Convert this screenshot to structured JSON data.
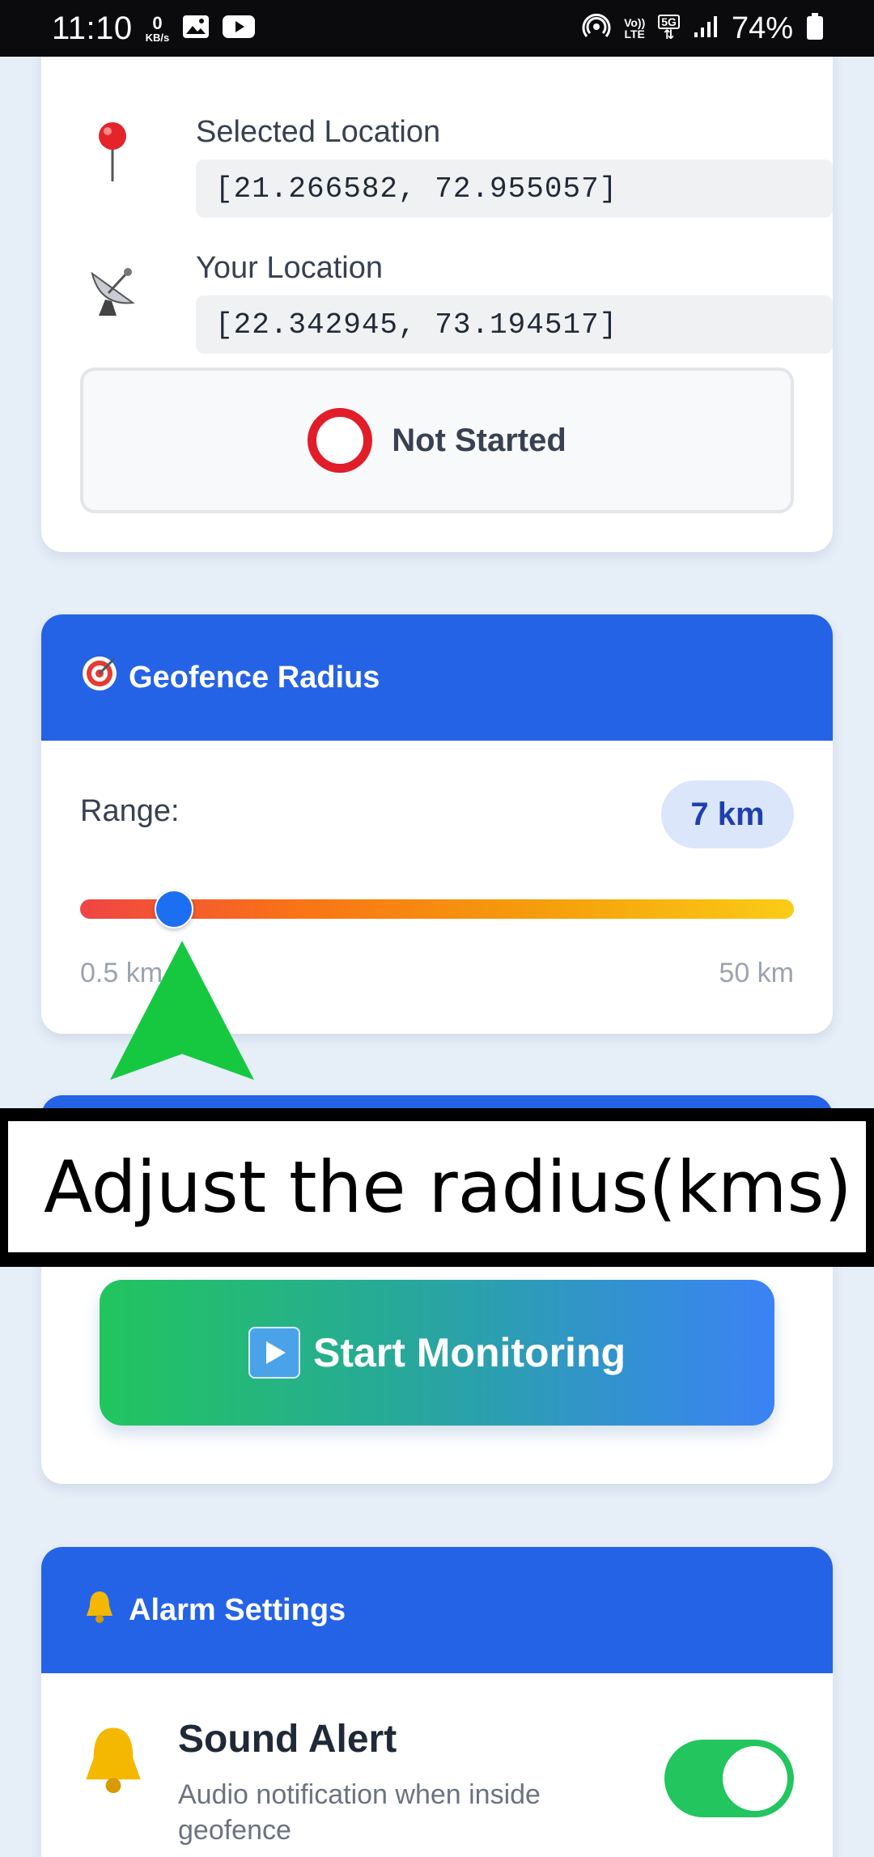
{
  "status_bar": {
    "time": "11:10",
    "net_speed_value": "0",
    "net_speed_unit": "KB/s",
    "volte_top": "Vo))",
    "volte_bottom": "LTE",
    "network_type": "5G",
    "battery": "74%"
  },
  "location_card": {
    "selected_label": "Selected Location",
    "selected_value": "[21.266582, 72.955057]",
    "your_label": "Your Location",
    "your_value": "[22.342945, 73.194517]",
    "status": "Not Started"
  },
  "radius_card": {
    "title": "Geofence Radius",
    "range_label": "Range:",
    "range_value": "7 km",
    "slider_min": 0.5,
    "slider_max": 50,
    "slider_value": 7,
    "min_label": "0.5 km",
    "max_label": "50 km"
  },
  "monitor_card": {
    "start_button": "Start Monitoring"
  },
  "alarm_card": {
    "title": "Alarm Settings",
    "sound_title": "Sound Alert",
    "sound_desc": "Audio notification when inside geofence",
    "sound_enabled": true
  },
  "overlay": {
    "caption": "Adjust the radius(kms)"
  },
  "colors": {
    "primary": "#2563e6",
    "status_ring": "#e11d2a",
    "toggle_on": "#22c55e",
    "arrow": "#16c840"
  }
}
